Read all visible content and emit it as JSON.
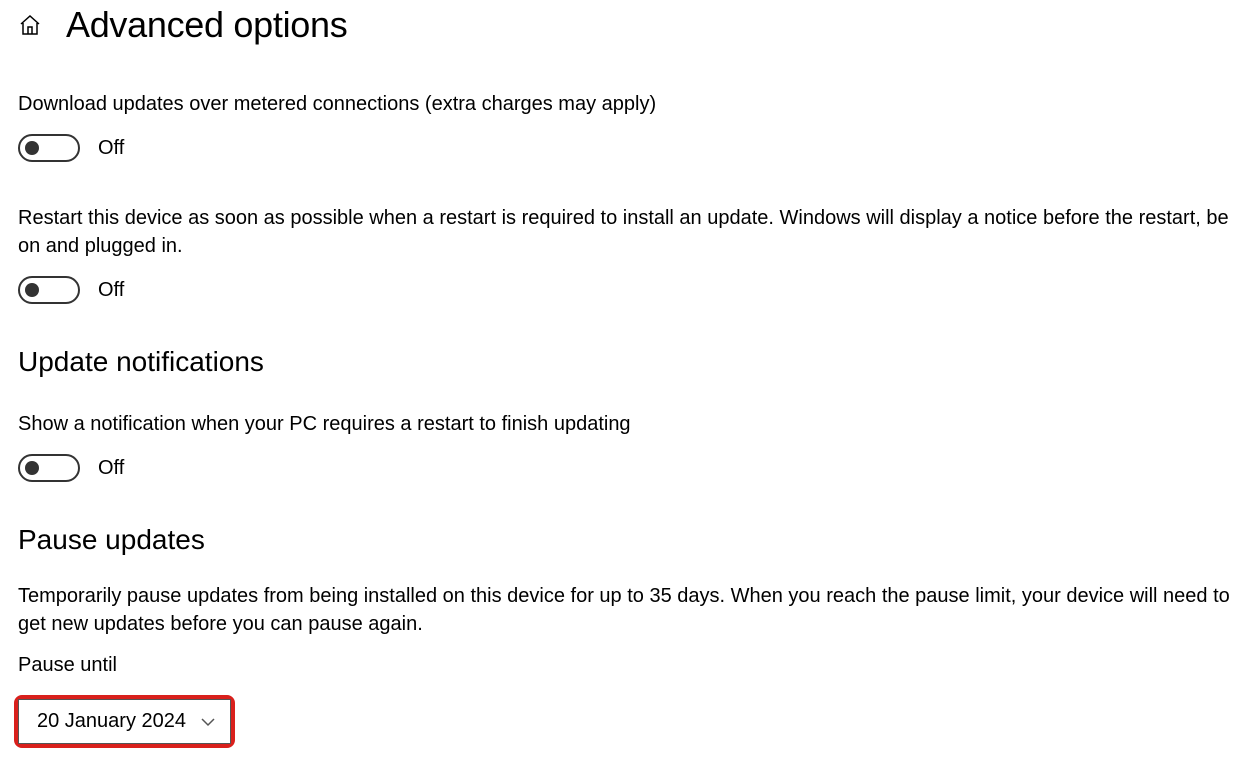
{
  "header": {
    "title": "Advanced options"
  },
  "settings": {
    "metered": {
      "desc": "Download updates over metered connections (extra charges may apply)",
      "state": "Off"
    },
    "restart": {
      "desc": "Restart this device as soon as possible when a restart is required to install an update. Windows will display a notice before the restart, be on and plugged in.",
      "state": "Off"
    }
  },
  "notifications": {
    "heading": "Update notifications",
    "desc": "Show a notification when your PC requires a restart to finish updating",
    "state": "Off"
  },
  "pause": {
    "heading": "Pause updates",
    "desc": "Temporarily pause updates from being installed on this device for up to 35 days. When you reach the pause limit, your device will need to get new updates before you can pause again.",
    "label": "Pause until",
    "value": "20 January 2024"
  }
}
